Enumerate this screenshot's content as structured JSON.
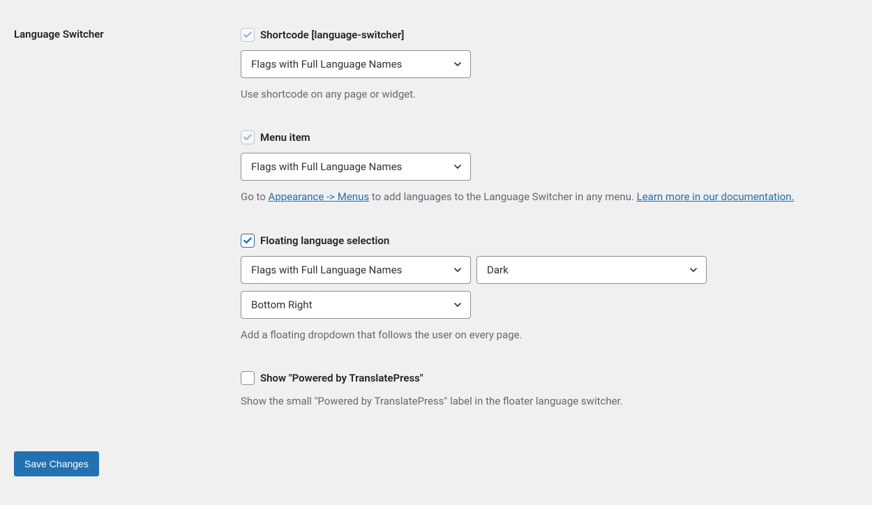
{
  "section_title": "Language Switcher",
  "shortcode": {
    "checked": true,
    "disabled": true,
    "label": "Shortcode [language-switcher]",
    "style_select": "Flags with Full Language Names",
    "help": "Use shortcode on any page or widget."
  },
  "menu_item": {
    "checked": true,
    "disabled": true,
    "label": "Menu item",
    "style_select": "Flags with Full Language Names",
    "help_prefix": "Go to ",
    "help_link1": "Appearance -> Menus",
    "help_mid": " to add languages to the Language Switcher in any menu. ",
    "help_link2": "Learn more in our documentation."
  },
  "floater": {
    "checked": true,
    "disabled": false,
    "label": "Floating language selection",
    "style_select": "Flags with Full Language Names",
    "theme_select": "Dark",
    "position_select": "Bottom Right",
    "help": "Add a floating dropdown that follows the user on every page."
  },
  "powered": {
    "checked": false,
    "label": "Show \"Powered by TranslatePress\"",
    "help": "Show the small \"Powered by TranslatePress\" label in the floater language switcher."
  },
  "save_button": "Save Changes"
}
